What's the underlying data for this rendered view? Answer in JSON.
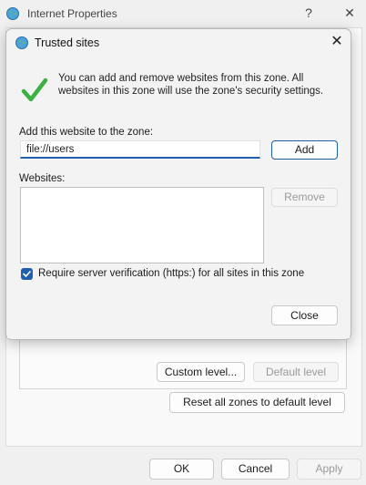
{
  "parent": {
    "title": "Internet Properties",
    "help_glyph": "?",
    "close_glyph": "✕",
    "custom_level_label": "Custom level...",
    "default_level_label": "Default level",
    "reset_all_label": "Reset all zones to default level",
    "ok_label": "OK",
    "cancel_label": "Cancel",
    "apply_label": "Apply"
  },
  "dialog": {
    "title": "Trusted sites",
    "close_glyph": "✕",
    "info_text": "You can add and remove websites from this zone. All websites in this zone will use the zone's security settings.",
    "add_label": "Add this website to the zone:",
    "site_input_value": "file://users",
    "add_button_label": "Add",
    "websites_label": "Websites:",
    "websites": [],
    "remove_button_label": "Remove",
    "https_checked": true,
    "https_label": "Require server verification (https:) for all sites in this zone",
    "close_button_label": "Close"
  },
  "colors": {
    "accent": "#1f5fae",
    "check_green": "#3cb043"
  },
  "icons": {
    "window": "globe-icon",
    "success": "checkmark-icon"
  }
}
